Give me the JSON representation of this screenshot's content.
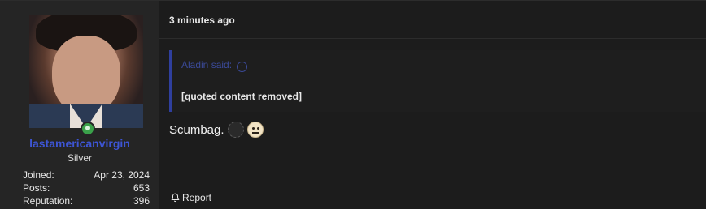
{
  "user": {
    "username": "lastamericanvirgin",
    "rank": "Silver",
    "stats": [
      {
        "label": "Joined:",
        "value": "Apr 23, 2024"
      },
      {
        "label": "Posts:",
        "value": "653"
      },
      {
        "label": "Reputation:",
        "value": "396"
      }
    ],
    "online_status_color": "#3aa14a",
    "username_color": "#3d55d4"
  },
  "post": {
    "timestamp": "3 minutes ago",
    "quote": {
      "author_label": "Aladin said:",
      "body": "[quoted content removed]"
    },
    "reply_text": "Scumbag.",
    "emojis": [
      "placeholder-emoji",
      "neutral-face-emoji"
    ],
    "report_label": "Report"
  },
  "colors": {
    "background": "#1c1c1c",
    "userbox": "#252525",
    "quote_accent": "#2f3f9e"
  }
}
